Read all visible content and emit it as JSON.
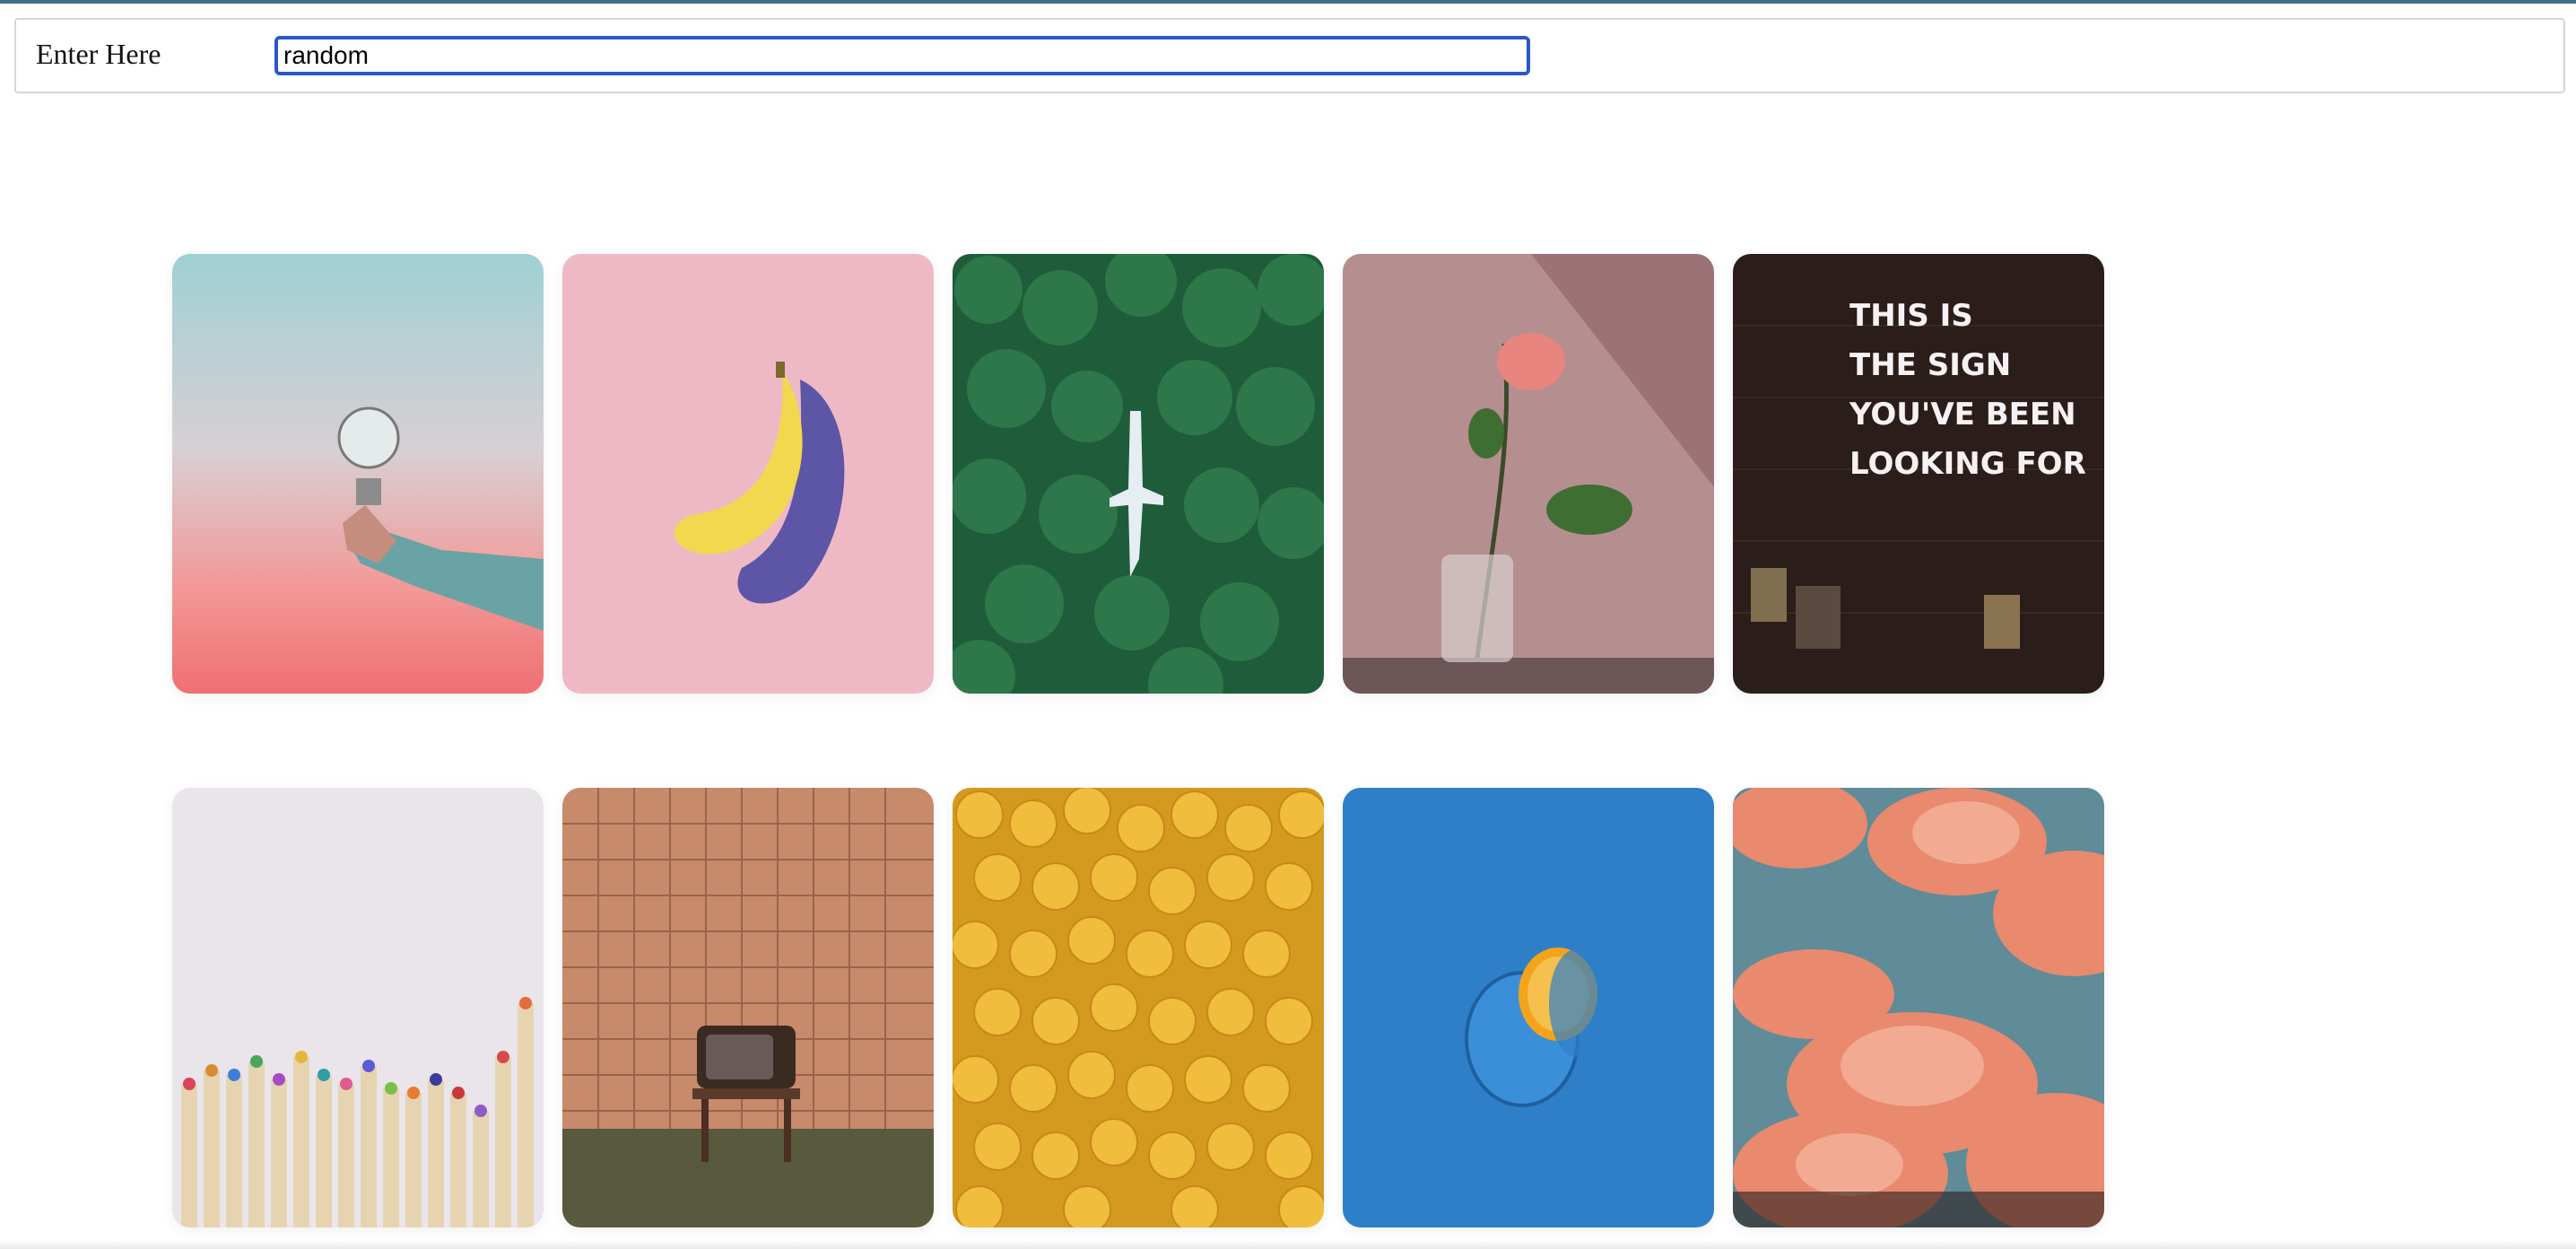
{
  "search": {
    "label": "Enter Here",
    "value": "random"
  },
  "gallery": {
    "images": [
      {
        "subject": "hand holding light bulb",
        "icon": "lightbulb-photo"
      },
      {
        "subject": "banana on pink",
        "icon": "banana-photo"
      },
      {
        "subject": "airplane in forest",
        "icon": "forest-airplane-photo"
      },
      {
        "subject": "rose in glass vase",
        "icon": "rose-photo"
      },
      {
        "subject": "neon sign",
        "icon": "neon-sign-photo",
        "text_lines": [
          "THIS IS",
          "THE SIGN",
          "YOU'VE BEEN",
          "LOOKING FOR"
        ]
      },
      {
        "subject": "colored pencils",
        "icon": "pencils-photo"
      },
      {
        "subject": "retro television",
        "icon": "tv-photo"
      },
      {
        "subject": "yellow toy heads",
        "icon": "yellow-heads-photo"
      },
      {
        "subject": "blue lemon",
        "icon": "blue-lemon-photo"
      },
      {
        "subject": "pink clouds",
        "icon": "clouds-photo"
      }
    ]
  },
  "colors": {
    "input_focus": "#2a57c9",
    "top_line": "#3f6f86"
  }
}
